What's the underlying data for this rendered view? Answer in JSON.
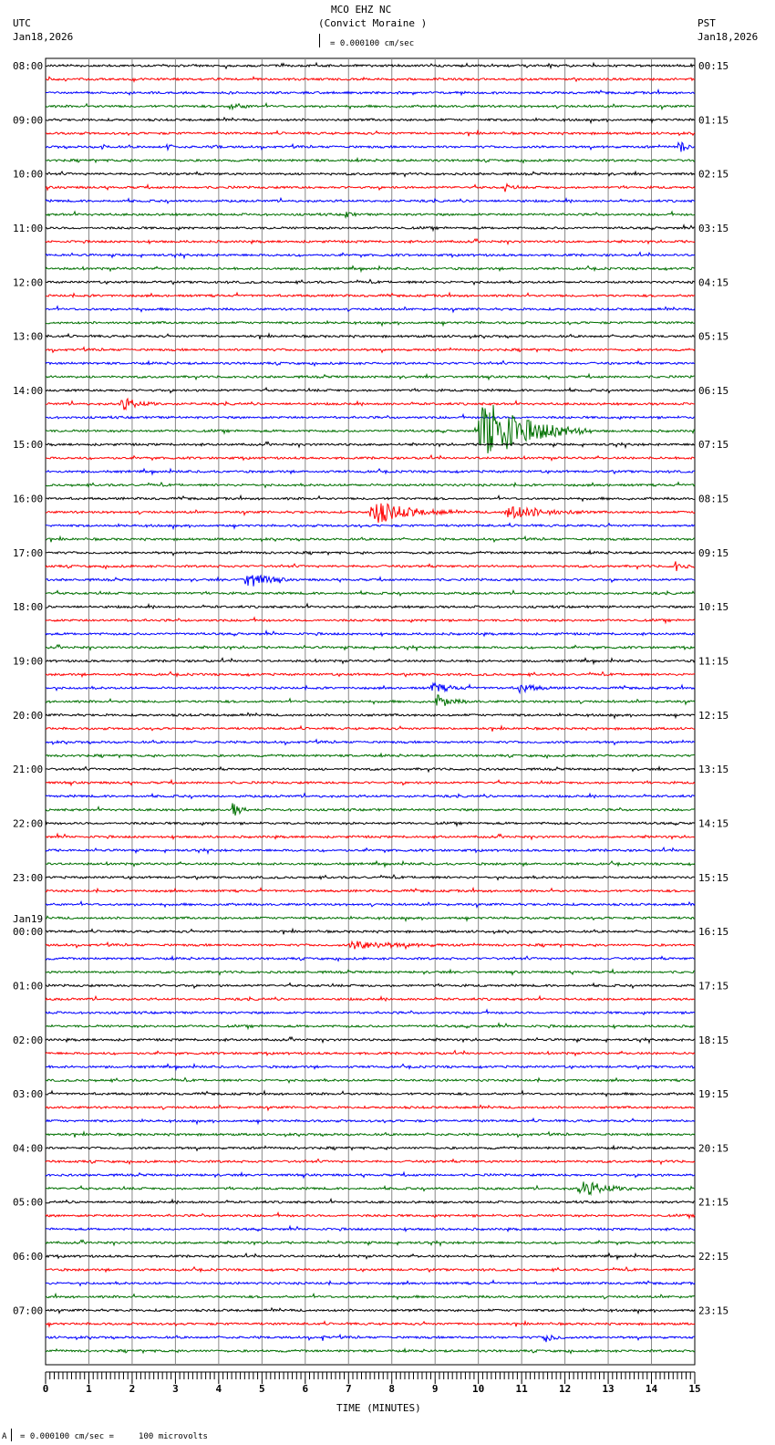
{
  "chart_data": {
    "type": "line",
    "title": "MCO EHZ NC",
    "subtitle": "(Convict Moraine )",
    "left_tz": "UTC",
    "left_date": "Jan18,2026",
    "right_tz": "PST",
    "right_date": "Jan18,2026",
    "scale_label": "= 0.000100 cm/sec",
    "footer_label": "= 0.000100 cm/sec =     100 microvolts",
    "footer_prefix": "A",
    "xlabel": "TIME (MINUTES)",
    "xlim": [
      0,
      15
    ],
    "x_ticks": [
      "0",
      "1",
      "2",
      "3",
      "4",
      "5",
      "6",
      "7",
      "8",
      "9",
      "10",
      "11",
      "12",
      "13",
      "14",
      "15"
    ],
    "trace_colors": [
      "#000000",
      "#ff0000",
      "#0000ff",
      "#007000"
    ],
    "traces_per_hour": 4,
    "trace_count": 96,
    "left_labels": [
      "08:00",
      "09:00",
      "10:00",
      "11:00",
      "12:00",
      "13:00",
      "14:00",
      "15:00",
      "16:00",
      "17:00",
      "18:00",
      "19:00",
      "20:00",
      "21:00",
      "22:00",
      "23:00",
      "00:00",
      "01:00",
      "02:00",
      "03:00",
      "04:00",
      "05:00",
      "06:00",
      "07:00"
    ],
    "date_change": {
      "hour_index": 16,
      "label": "Jan19"
    },
    "right_labels": [
      "00:15",
      "01:15",
      "02:15",
      "03:15",
      "04:15",
      "05:15",
      "06:15",
      "07:15",
      "08:15",
      "09:15",
      "10:15",
      "11:15",
      "12:15",
      "13:15",
      "14:15",
      "15:15",
      "16:15",
      "17:15",
      "18:15",
      "19:15",
      "20:15",
      "21:15",
      "22:15",
      "23:15"
    ],
    "events": [
      {
        "trace": 3,
        "minute": 4.2,
        "amp": 4,
        "dur": 0.8
      },
      {
        "trace": 6,
        "minute": 1.3,
        "amp": 4,
        "dur": 0.2
      },
      {
        "trace": 6,
        "minute": 2.8,
        "amp": 5,
        "dur": 0.2
      },
      {
        "trace": 6,
        "minute": 3.9,
        "amp": 4,
        "dur": 0.2
      },
      {
        "trace": 6,
        "minute": 14.6,
        "amp": 14,
        "dur": 0.3
      },
      {
        "trace": 9,
        "minute": 10.6,
        "amp": 6,
        "dur": 0.3
      },
      {
        "trace": 11,
        "minute": 6.9,
        "amp": 6,
        "dur": 0.3
      },
      {
        "trace": 25,
        "minute": 1.7,
        "amp": 8,
        "dur": 1.0
      },
      {
        "trace": 27,
        "minute": 10.0,
        "amp": 45,
        "dur": 2.5
      },
      {
        "trace": 33,
        "minute": 7.5,
        "amp": 15,
        "dur": 2.0
      },
      {
        "trace": 33,
        "minute": 10.6,
        "amp": 9,
        "dur": 2.0
      },
      {
        "trace": 37,
        "minute": 14.5,
        "amp": 7,
        "dur": 0.5
      },
      {
        "trace": 38,
        "minute": 4.6,
        "amp": 12,
        "dur": 1.0
      },
      {
        "trace": 46,
        "minute": 8.9,
        "amp": 6,
        "dur": 1.0
      },
      {
        "trace": 46,
        "minute": 10.9,
        "amp": 6,
        "dur": 0.9
      },
      {
        "trace": 47,
        "minute": 9.0,
        "amp": 9,
        "dur": 0.8
      },
      {
        "trace": 55,
        "minute": 4.3,
        "amp": 12,
        "dur": 0.4
      },
      {
        "trace": 65,
        "minute": 7.0,
        "amp": 5,
        "dur": 2.5
      },
      {
        "trace": 83,
        "minute": 12.3,
        "amp": 10,
        "dur": 1.5
      },
      {
        "trace": 94,
        "minute": 11.5,
        "amp": 6,
        "dur": 0.6
      },
      {
        "trace": 94,
        "minute": 6.4,
        "amp": 5,
        "dur": 0.1
      }
    ]
  }
}
